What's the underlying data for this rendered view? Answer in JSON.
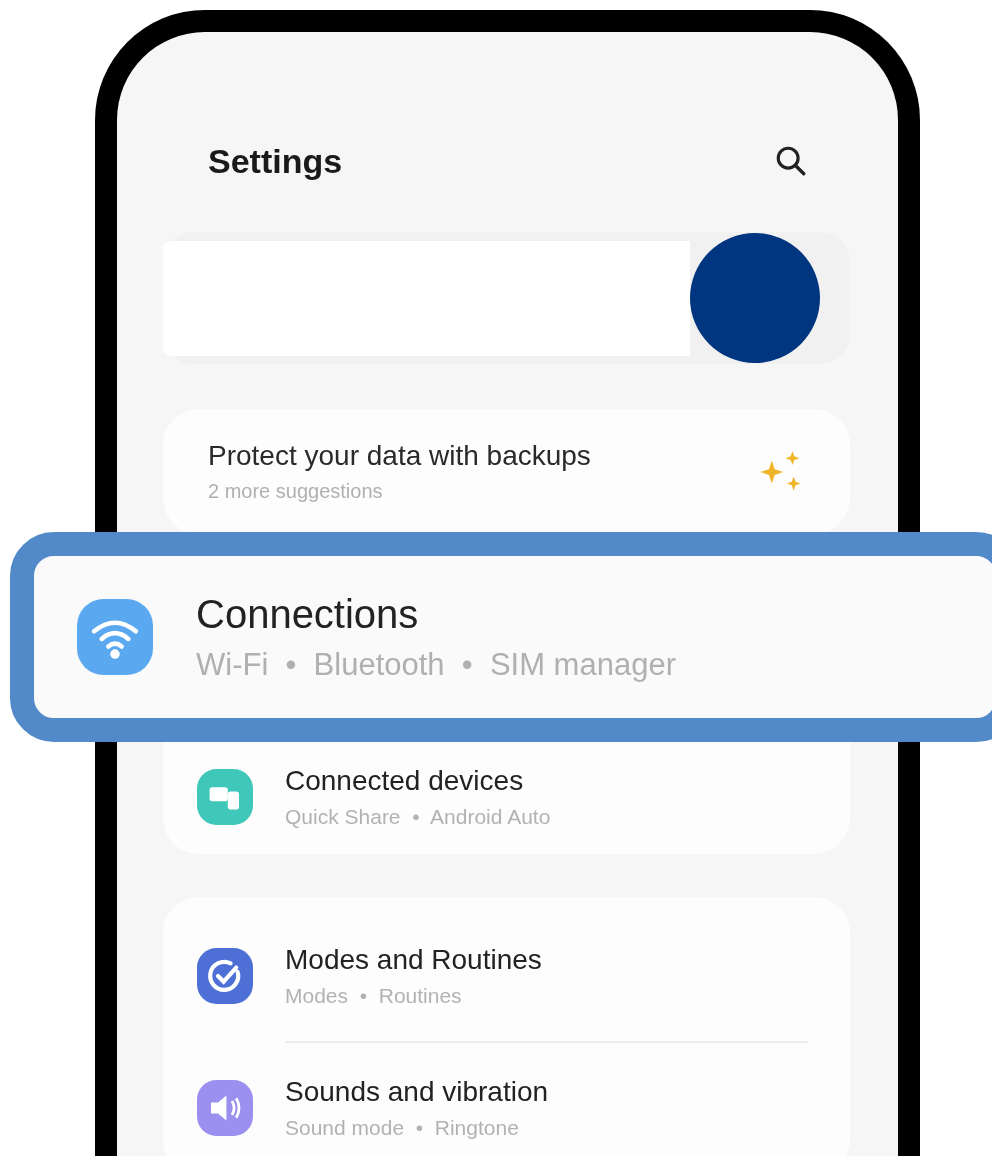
{
  "header": {
    "title": "Settings"
  },
  "suggestion": {
    "title": "Protect your data with backups",
    "subtitle": "2 more suggestions"
  },
  "highlighted_item": {
    "kind": "wifi",
    "title": "Connections",
    "subtitle": "Wi-Fi  •  Bluetooth  •  SIM manager"
  },
  "groups": [
    {
      "items": [
        {
          "kind": "devices",
          "title": "Connected devices",
          "subtitle": "Quick Share  •  Android Auto"
        }
      ]
    },
    {
      "items": [
        {
          "kind": "modes",
          "title": "Modes and Routines",
          "subtitle": "Modes  •  Routines"
        },
        {
          "kind": "sounds",
          "title": "Sounds and vibration",
          "subtitle": "Sound mode  •  Ringtone"
        }
      ]
    }
  ]
}
